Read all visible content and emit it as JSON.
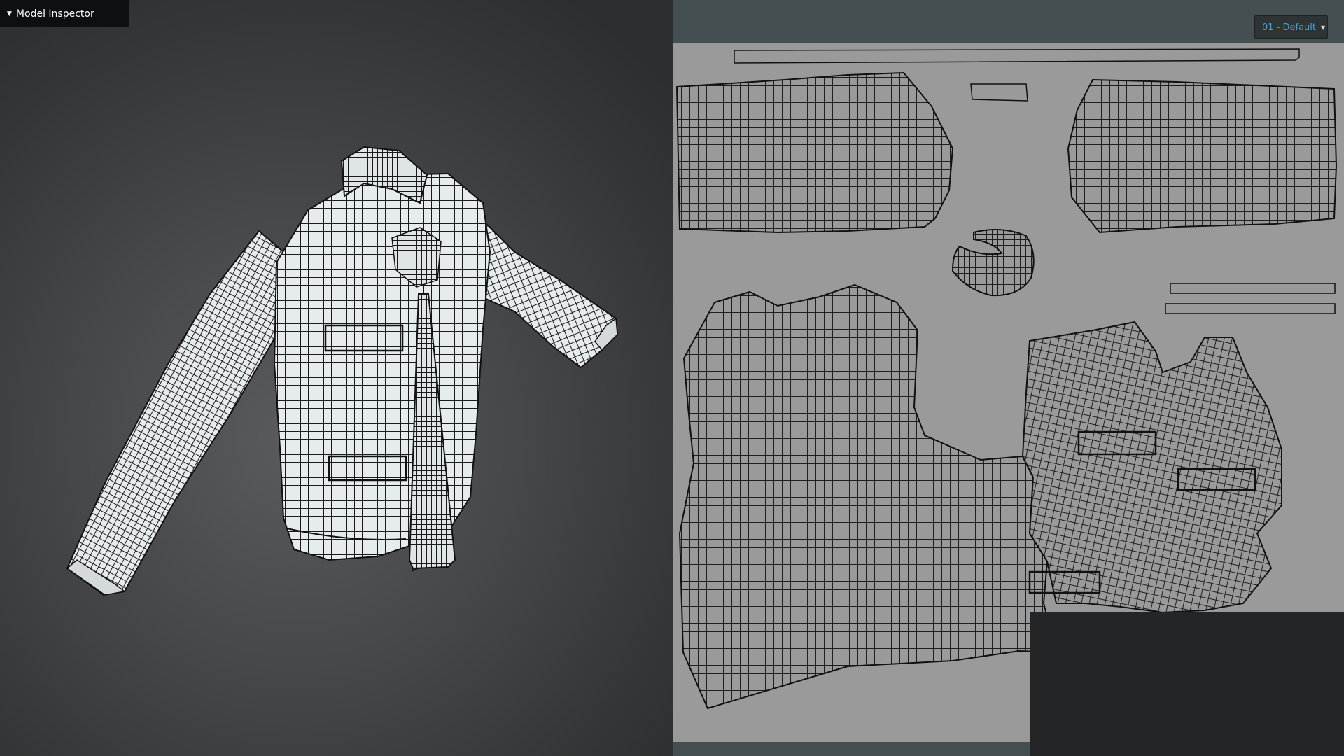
{
  "inspector": {
    "title": "Model Inspector",
    "caret_icon": "triangle-down-icon"
  },
  "material": {
    "selected": "01 - Default",
    "chevron_icon": "chevron-down-icon",
    "accent_color": "#3fa3e0"
  },
  "colors": {
    "viewport_center": "#595b5c",
    "uv_background": "#9a9a9a",
    "uv_frame": "#454f51",
    "wire": "#111111",
    "mesh_fill": "#e6ebeb"
  }
}
